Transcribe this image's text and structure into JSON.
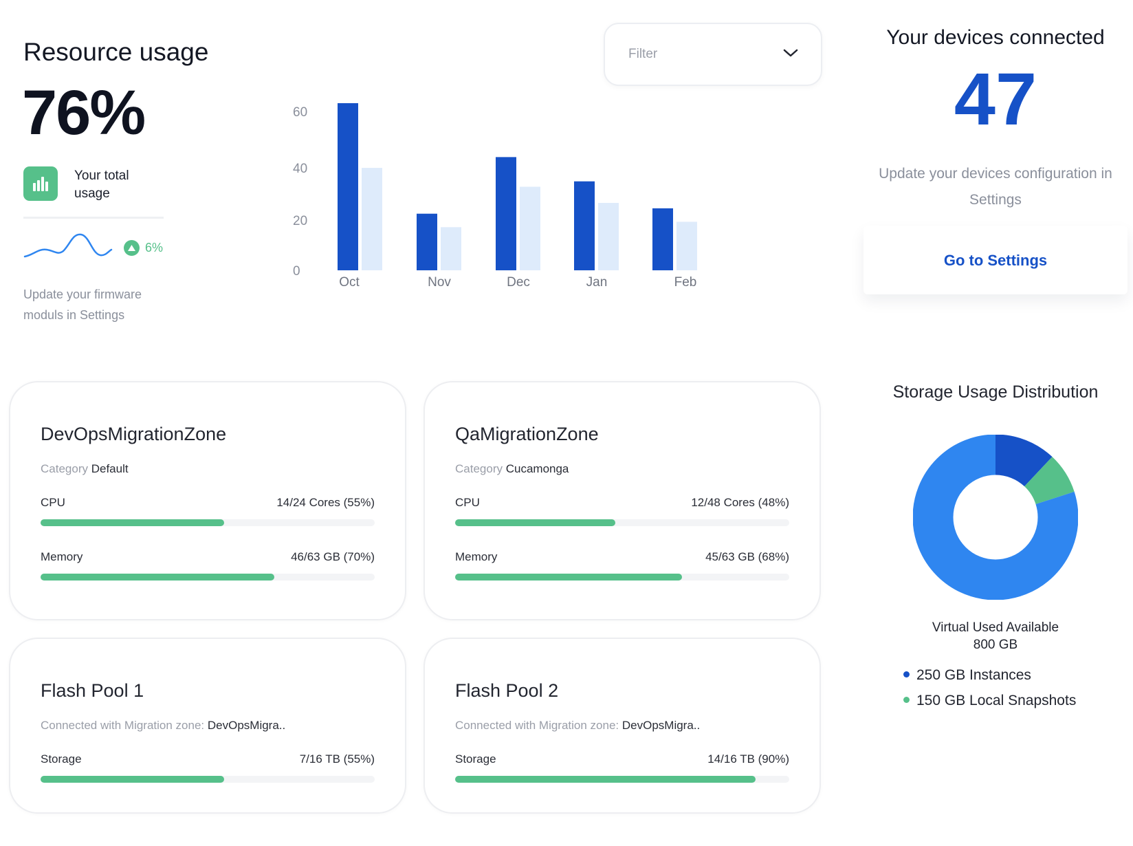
{
  "resource_usage": {
    "title": "Resource usage",
    "value": "76%",
    "total_label": "Your total usage",
    "trend": "6%",
    "note": "Update your firmware moduls in Settings"
  },
  "filter": {
    "label": "Filter"
  },
  "chart_data": {
    "type": "bar",
    "categories": [
      "Oct",
      "Nov",
      "Dec",
      "Jan",
      "Feb"
    ],
    "series": [
      {
        "values": [
          62,
          21,
          42,
          33,
          23
        ],
        "color": "#1651c7"
      },
      {
        "values": [
          38,
          16,
          31,
          25,
          18
        ],
        "color": "#deebfb"
      }
    ],
    "yticks": [
      "0",
      "20",
      "40",
      "60"
    ],
    "ylim": [
      0,
      62
    ],
    "grid": false,
    "legend": "none"
  },
  "devices": {
    "title": "Your devices connected",
    "count": "47",
    "note": "Update your devices configuration in Settings",
    "button": "Go to Settings"
  },
  "zones": [
    {
      "name": "DevOpsMigrationZone",
      "category_label": "Category",
      "category": "Default",
      "cpu_label": "CPU",
      "cpu_value": "14/24 Cores (55%)",
      "cpu_fraction": 0.55,
      "mem_label": "Memory",
      "mem_value": "46/63 GB (70%)",
      "mem_fraction": 0.7
    },
    {
      "name": "QaMigrationZone",
      "category_label": "Category",
      "category": "Cucamonga",
      "cpu_label": "CPU",
      "cpu_value": "12/48 Cores (48%)",
      "cpu_fraction": 0.48,
      "mem_label": "Memory",
      "mem_value": "45/63 GB (68%)",
      "mem_fraction": 0.68
    }
  ],
  "pools": [
    {
      "name": "Flash Pool 1",
      "connected_label": "Connected with Migration zone:",
      "connected_zone": "DevOpsMigra..",
      "storage_label": "Storage",
      "storage_value": "7/16 TB (55%)",
      "storage_fraction": 0.55
    },
    {
      "name": "Flash Pool 2",
      "connected_label": "Connected with Migration zone:",
      "connected_zone": "DevOpsMigra..",
      "storage_label": "Storage",
      "storage_value": "14/16 TB (90%)",
      "storage_fraction": 0.9
    }
  ],
  "storage": {
    "title": "Storage Usage Distribution",
    "center_line1": "Virtual Used Available",
    "center_line2": "800 GB",
    "legend": [
      {
        "label": "250 GB Instances",
        "color": "#1651c7"
      },
      {
        "label": "150 GB Local Snapshots",
        "color": "#56c08a"
      }
    ],
    "donut_fractions": [
      0.12,
      0.08,
      0.8
    ],
    "donut_colors": [
      "#1651c7",
      "#56c08a",
      "#2f86f0"
    ]
  }
}
